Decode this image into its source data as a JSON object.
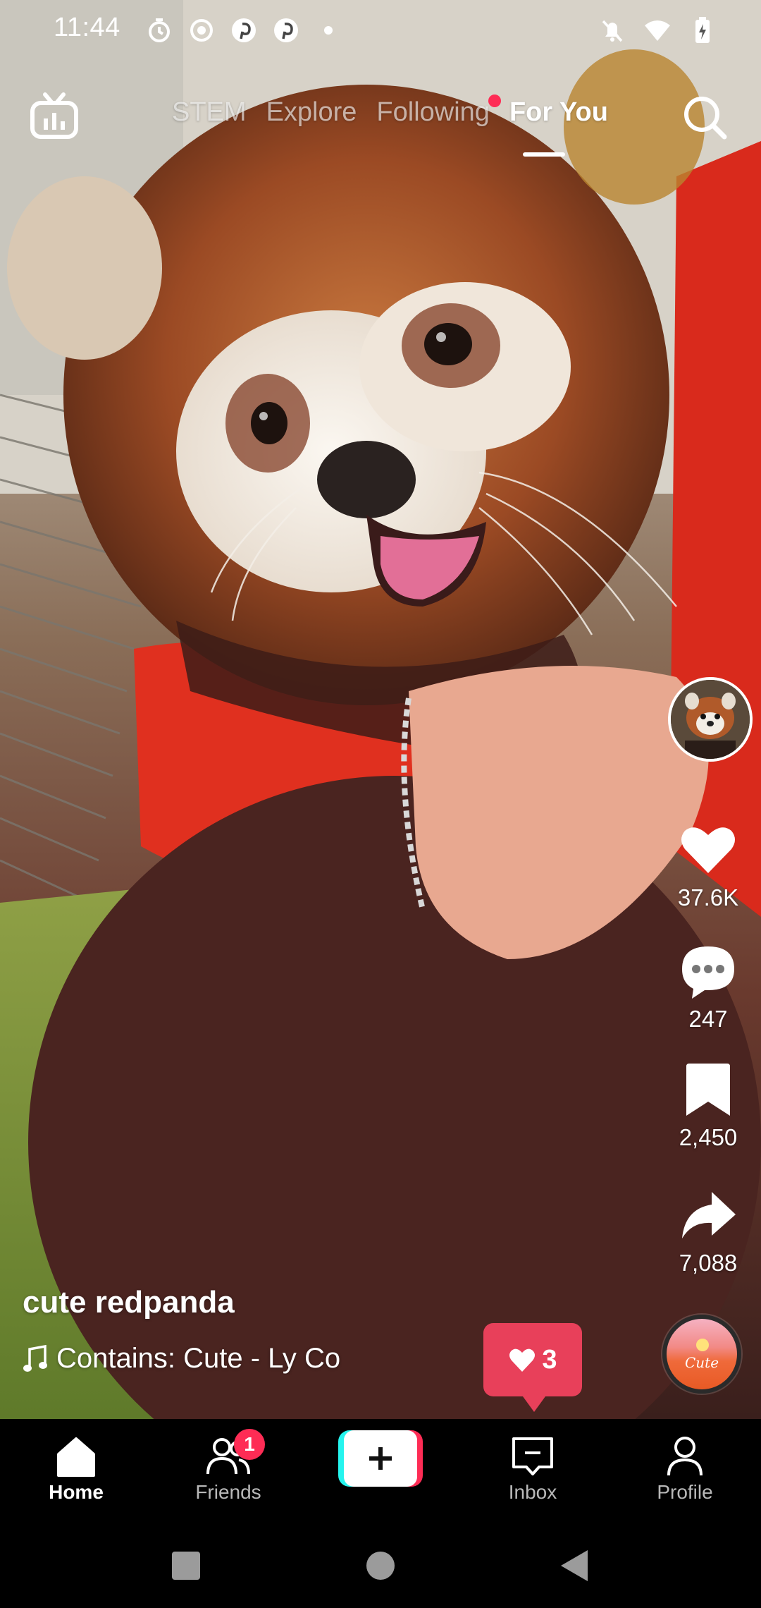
{
  "status_bar": {
    "time": "11:44",
    "left_icons": [
      "timer-icon",
      "record-icon",
      "pinterest-icon",
      "pinterest-icon",
      "dot-icon"
    ],
    "right_icons": [
      "notifications-off-icon",
      "wifi-icon",
      "battery-charging-icon"
    ]
  },
  "top_nav": {
    "tabs": [
      {
        "label": "STEM",
        "active": false
      },
      {
        "label": "Explore",
        "active": false
      },
      {
        "label": "Following",
        "active": false,
        "has_dot": true
      },
      {
        "label": "For You",
        "active": true
      }
    ]
  },
  "video": {
    "description_visual": "red-panda"
  },
  "actions": {
    "likes": "37.6K",
    "comments": "247",
    "saves": "2,450",
    "shares": "7,088"
  },
  "caption": {
    "username": "cute redpanda",
    "sound": "Contains: Cute - Ly    Co"
  },
  "like_bubble": {
    "count": "3"
  },
  "music_disc": {
    "text": "Cute"
  },
  "bottom_nav": {
    "items": [
      {
        "label": "Home",
        "active": true
      },
      {
        "label": "Friends",
        "badge": "1"
      },
      {
        "label": ""
      },
      {
        "label": "Inbox"
      },
      {
        "label": "Profile"
      }
    ]
  },
  "colors": {
    "accent": "#fe2c55",
    "cyan": "#25f4ee",
    "like_bubble": "#e8405a"
  }
}
